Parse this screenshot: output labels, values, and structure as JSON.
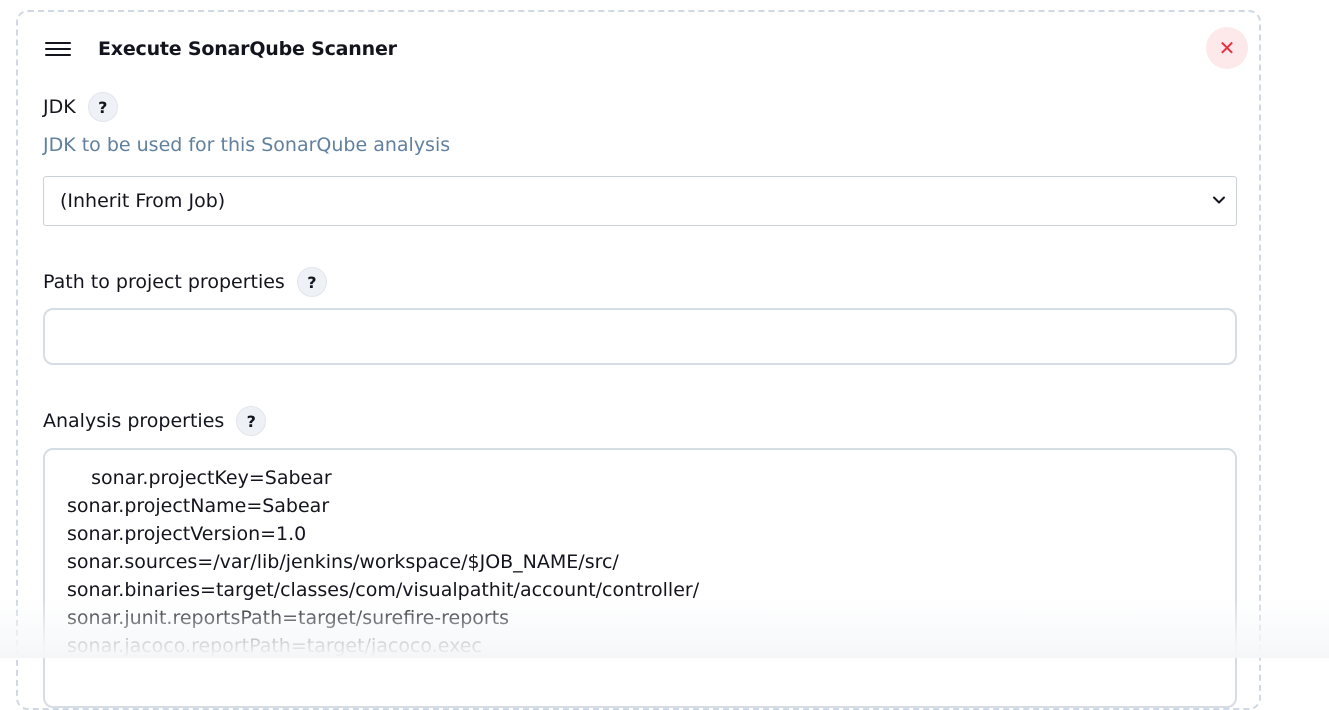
{
  "step": {
    "title": "Execute SonarQube Scanner",
    "close_icon": "close-icon",
    "drag_icon": "hamburger-icon"
  },
  "jdk": {
    "label": "JDK",
    "help": "?",
    "description": "JDK to be used for this SonarQube analysis",
    "selected": "(Inherit From Job)"
  },
  "project_properties": {
    "label": "Path to project properties",
    "help": "?",
    "value": ""
  },
  "analysis_properties": {
    "label": "Analysis properties",
    "help": "?",
    "value": "    sonar.projectKey=Sabear\nsonar.projectName=Sabear\nsonar.projectVersion=1.0\nsonar.sources=/var/lib/jenkins/workspace/$JOB_NAME/src/\nsonar.binaries=target/classes/com/visualpathit/account/controller/\nsonar.junit.reportsPath=target/surefire-reports\nsonar.jacoco.reportPath=target/jacoco.exec"
  },
  "colors": {
    "close_bg": "#fde8ea",
    "close_fg": "#e5303f",
    "description": "#60809e"
  }
}
